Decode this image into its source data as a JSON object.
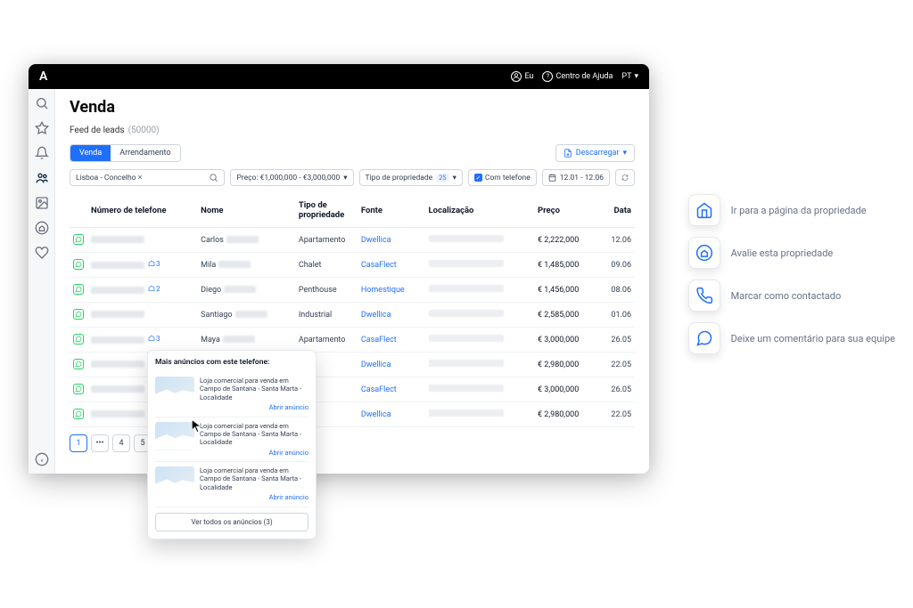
{
  "topbar": {
    "user_label": "Eu",
    "help_label": "Centro de Ajuda",
    "lang": "PT"
  },
  "page": {
    "title": "Venda",
    "feed_label": "Feed de leads",
    "feed_count": "(50000)"
  },
  "tabs": {
    "sale": "Venda",
    "rent": "Arrendamento"
  },
  "download": "Descarregar",
  "filters": {
    "location": "Lisboa - Concelho",
    "price": "Preço: €1,000,000 - €3,000,000",
    "prop_type": "Tipo de propriedade",
    "prop_type_count": "25",
    "with_phone": "Com telefone",
    "date_range": "12.01 - 12.06"
  },
  "columns": {
    "phone": "Número de telefone",
    "name": "Nome",
    "prop": "Tipo de propriedade",
    "source": "Fonte",
    "loc": "Localização",
    "price": "Preço",
    "date": "Data"
  },
  "rows": [
    {
      "badge": "",
      "name": "Carlos",
      "prop": "Apartamento",
      "source": "Dwellica",
      "price": "€ 2,222,000",
      "date": "12.06"
    },
    {
      "badge": "3",
      "name": "Mila",
      "prop": "Chalet",
      "source": "CasaFlect",
      "price": "€ 1,485,000",
      "date": "09.06"
    },
    {
      "badge": "2",
      "name": "Diego",
      "prop": "Penthouse",
      "source": "Homestique",
      "price": "€ 1,456,000",
      "date": "08.06"
    },
    {
      "badge": "",
      "name": "Santiago",
      "prop": "Industrial",
      "source": "Dwellica",
      "price": "€ 2,585,000",
      "date": "01.06"
    },
    {
      "badge": "3",
      "name": "Maya",
      "prop": "Apartamento",
      "source": "CasaFlect",
      "price": "€ 3,000,000",
      "date": "26.05"
    },
    {
      "badge": "",
      "name": "",
      "prop": "",
      "source": "Dwellica",
      "price": "€ 2,980,000",
      "date": "22.05"
    },
    {
      "badge": "",
      "name": "",
      "prop": "",
      "source": "CasaFlect",
      "price": "€ 3,000,000",
      "date": "26.05"
    },
    {
      "badge": "",
      "name": "",
      "prop": "",
      "source": "Dwellica",
      "price": "€ 2,980,000",
      "date": "22.05"
    }
  ],
  "pagination": {
    "p1": "1",
    "dots": "•••",
    "p4": "4",
    "p5": "5"
  },
  "popover": {
    "title": "Mais anúncios com este telefone:",
    "item_text": "Loja comercial para venda em Campo de Santana - Santa Marta - Localidade",
    "open": "Abrir anúncio",
    "all": "Ver todos os anúncios (3)"
  },
  "actions": {
    "goto": "Ir para a página da propriedade",
    "rate": "Avalie esta propriedade",
    "contacted": "Marcar como contactado",
    "comment": "Deixe um comentário para sua equipe"
  }
}
